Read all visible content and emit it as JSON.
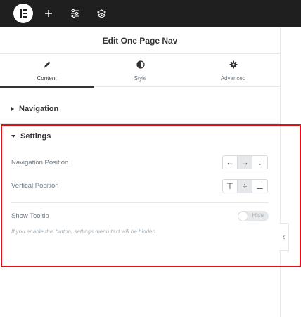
{
  "topbar": {
    "logo_icon": "elementor-logo-icon",
    "icons": [
      "plus-icon",
      "sliders-icon",
      "layers-icon"
    ]
  },
  "panel": {
    "title": "Edit One Page Nav"
  },
  "tabs": [
    {
      "label": "Content",
      "icon": "pencil-icon",
      "active": true
    },
    {
      "label": "Style",
      "icon": "half-circle-icon",
      "active": false
    },
    {
      "label": "Advanced",
      "icon": "gear-icon",
      "active": false
    }
  ],
  "sections": {
    "navigation": {
      "label": "Navigation",
      "expanded": false
    },
    "settings": {
      "label": "Settings",
      "expanded": true,
      "navigation_position": {
        "label": "Navigation Position",
        "options": [
          "←",
          "→",
          "↓"
        ],
        "selected_index": 1
      },
      "vertical_position": {
        "label": "Vertical Position",
        "options": [
          "⊤",
          "÷",
          "⊥"
        ],
        "selected_index": 1
      },
      "show_tooltip": {
        "label": "Show Tooltip",
        "toggle_text": "Hide",
        "enabled": false,
        "help": "If you enable this button, settings menu text will be hidden."
      }
    }
  },
  "colors": {
    "topbar": "#1f1f1f",
    "highlight": "#e0101b",
    "border": "#e6e8ea"
  },
  "collapse_handle": {
    "glyph": "‹",
    "icon": "chevron-left-icon"
  }
}
